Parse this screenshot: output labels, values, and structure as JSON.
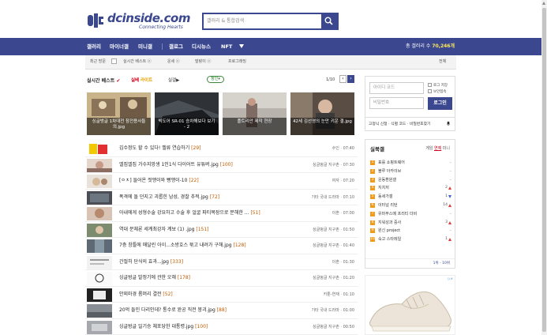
{
  "header": {
    "logo_text": "dcinside.com",
    "logo_sub": "Connecting Hearts",
    "search_placeholder": "갤러리 & 통합검색"
  },
  "nav": {
    "items": [
      "갤러리",
      "마이너갤",
      "미니갤",
      "갤로그",
      "디시뉴스",
      "NFT"
    ],
    "gallery_count_label": "총 갤러리 수",
    "gallery_count": "70,246개"
  },
  "subnav": {
    "recent": "최근 방문",
    "items": [
      "실시간 베스트 ⓧ",
      "운세 ⓧ",
      "말랑이 ⓧ",
      "프로그래밍"
    ],
    "all": "전체"
  },
  "realtime": {
    "title_prefix": "실시간 베스트",
    "tabs": [
      "실베",
      "라이트",
      "실갤▶"
    ],
    "badge": "정인▾",
    "page": "1/10"
  },
  "cards": [
    {
      "caption": "싱글벙글 1차대전 참전용사들의.jpg"
    },
    {
      "caption": "빅도어 SR-01 승차해보다 보기 - 2"
    },
    {
      "caption": "플트리안 제작 현장"
    },
    {
      "caption": "42세 김선영의 눈만 키운 결.jpg"
    }
  ],
  "list": [
    {
      "title": "김수정도 할 수 있다! 벨류 연습하기",
      "count": "[29]",
      "meta": "수인 · 07:40"
    },
    {
      "title": "엘집엘집 가수지망생 1인1식 다이어트 유튜버.jpg",
      "count": "[100]",
      "meta": "싱글벙글 지구촌 · 07:30"
    },
    {
      "title": "[ㅇㅊ] 들어온 젓맹이와 뻥맹이-10",
      "count": "[22]",
      "meta": "여자 · 07:20"
    },
    {
      "title": "폭격에 돌 던지고 괴롭힌 남성, 경찰 추적.jpg",
      "count": "[72]",
      "meta": "기타 국내 드라마 · 07:10"
    },
    {
      "title": "아내에게 성형수술 강요하고 수술 후 얼굴 파티복장으로 분해한 ...",
      "count": "[51]",
      "meta": "이혼 · 07:00"
    },
    {
      "title": "역대 문체론 세계최강자 계보 (1) .jpg",
      "count": "[151]",
      "meta": "싱글벙글 지구촌 · 01:50"
    },
    {
      "title": "7층 창틀에 매달린 아이...소방호스 묶고 내려가 구해.jpg",
      "count": "[128]",
      "meta": "싱글벙글 지구촌 · 01:40"
    },
    {
      "title": "간절히 단식의 효과...jpg",
      "count": "[333]",
      "meta": "이혼 · 01:30"
    },
    {
      "title": "싱글벙글 발정기에 관한 오해",
      "count": "[178]",
      "meta": "싱글벙글 지구촌 · 01:20"
    },
    {
      "title": "안외마경 롬머리 결전",
      "count": "[52]",
      "meta": "카툰-연재 · 01:10"
    },
    {
      "title": "20억 들인 다리인데? 통수로 완공 직전 붕괴.jpg",
      "count": "[88]",
      "meta": "기타 국내 드라마 · 01:00"
    },
    {
      "title": "싱글벙글 일기승 체포당한 대통령.jpg",
      "count": "[100]",
      "meta": "싱글벙글 지구촌 · 00:50"
    }
  ],
  "login": {
    "id_placeholder": "아이디 코드",
    "pw_placeholder": "비밀번호",
    "keep_login": "로그 저장",
    "secure": "보안접속",
    "login_button": "로그인",
    "bottom_text": "고정닉 신청 · 식별 코드 · 비밀번호찾기"
  },
  "side": {
    "title": "실북갤",
    "tabs": [
      "게임",
      "연예",
      "미니"
    ],
    "items": [
      {
        "n": "1",
        "name": "표를 쇼핑트웨어",
        "rank": "",
        "trend": "dash"
      },
      {
        "n": "2",
        "name": "블루 아카이브",
        "rank": "",
        "trend": "dash"
      },
      {
        "n": "3",
        "name": "운동환원갤",
        "rank": "",
        "trend": "dash"
      },
      {
        "n": "4",
        "name": "지치저",
        "rank": "2",
        "trend": "up"
      },
      {
        "n": "5",
        "name": "동세가갤",
        "rank": "1",
        "trend": "dn"
      },
      {
        "n": "6",
        "name": "이터널 리턴",
        "rank": "14",
        "trend": "up"
      },
      {
        "n": "7",
        "name": "유마무스메 프리티 더비",
        "rank": "",
        "trend": "dash"
      },
      {
        "n": "8",
        "name": "지워성과 중사",
        "rank": "3",
        "trend": "up"
      },
      {
        "n": "9",
        "name": "원신 project",
        "rank": "",
        "trend": "dash"
      },
      {
        "n": "10",
        "name": "숙고 스타레일",
        "rank": "1",
        "trend": "up"
      }
    ],
    "footer": "1위 - 10위"
  },
  "ad_mark": "▷×"
}
